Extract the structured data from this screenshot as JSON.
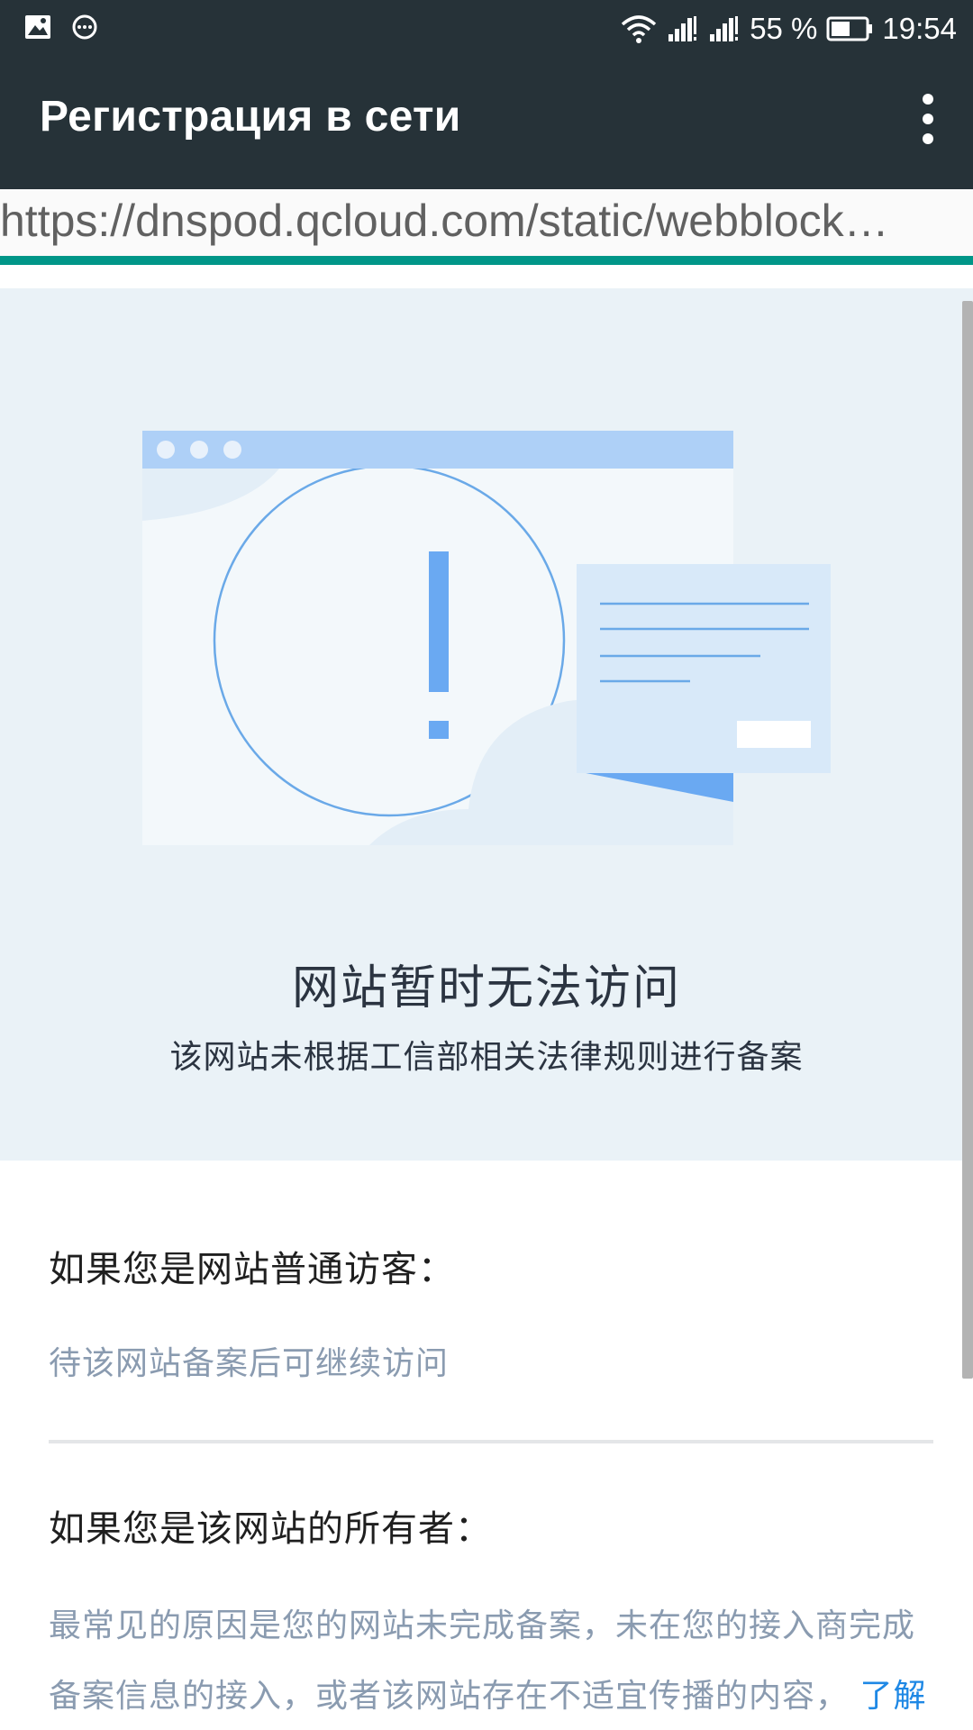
{
  "status_bar": {
    "battery_percent": "55 %",
    "time": "19:54",
    "icons": [
      "image-notification-icon",
      "chat-notification-icon",
      "wifi-icon",
      "signal-sim1-icon",
      "signal-sim2-icon",
      "battery-icon"
    ]
  },
  "toolbar": {
    "title": "Регистрация в сети",
    "menu_icon": "more-vert-icon"
  },
  "url_bar": {
    "url": "https://dnspod.qcloud.com/static/webblock…"
  },
  "hero": {
    "title": "网站暂时无法访问",
    "subtitle": "该网站未根据工信部相关法律规则进行备案",
    "illustration": "browser-window-warning-illustration",
    "colors": {
      "background": "#eaf2f7",
      "accent_blue": "#6aa9f2",
      "window_bar": "#aed0f7"
    }
  },
  "visitor_section": {
    "heading": "如果您是网站普通访客：",
    "body": "待该网站备案后可继续访问"
  },
  "owner_section": {
    "heading": "如果您是该网站的所有者：",
    "body": "最常见的原因是您的网站未完成备案，未在您的接入商完成备案信息的接入，或者该网站存在不适宜传播的内容，",
    "link": "了解"
  },
  "colors": {
    "toolbar_bg": "#263238",
    "progress_accent": "#009688",
    "link": "#1e88e5"
  }
}
